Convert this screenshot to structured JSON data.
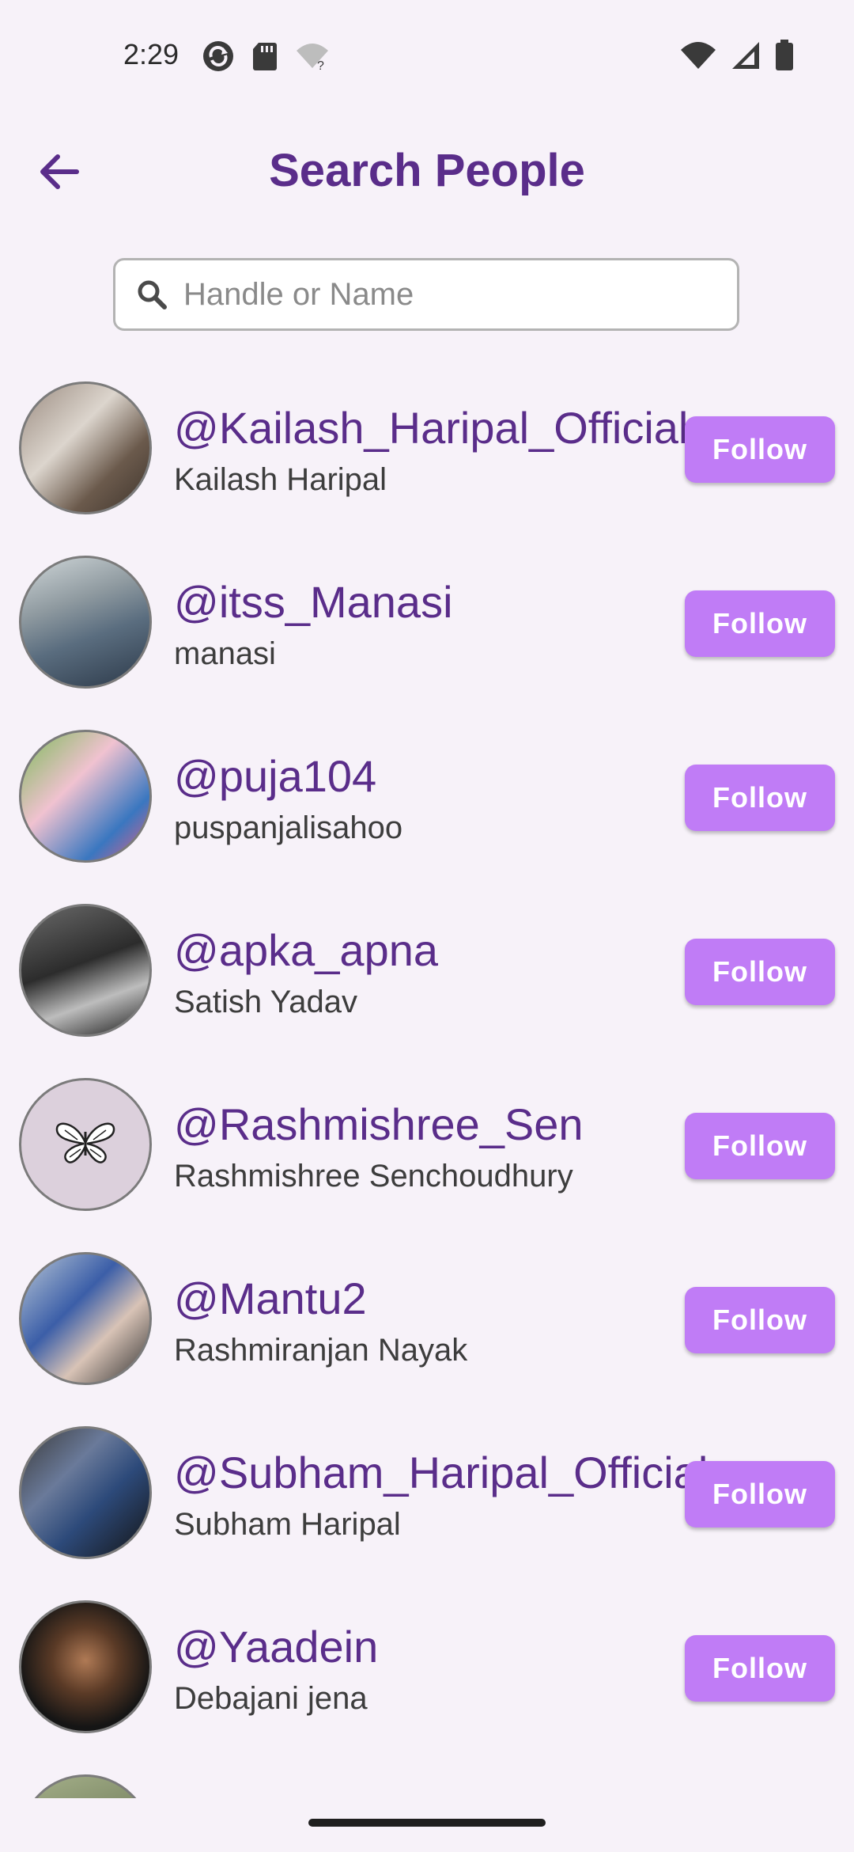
{
  "status_bar": {
    "time": "2:29",
    "left_icons": [
      "sync-icon",
      "sd-card-icon",
      "wifi-question-icon"
    ],
    "right_icons": [
      "wifi-icon",
      "signal-icon",
      "battery-icon"
    ]
  },
  "app_bar": {
    "title": "Search People",
    "back_icon": "arrow-left-icon"
  },
  "search": {
    "placeholder": "Handle or Name",
    "value": ""
  },
  "people": [
    {
      "handle": "@Kailash_Haripal_Official",
      "name": "Kailash Haripal",
      "button": "Follow"
    },
    {
      "handle": "@itss_Manasi",
      "name": "manasi",
      "button": "Follow"
    },
    {
      "handle": "@puja104",
      "name": "puspanjalisahoo",
      "button": "Follow"
    },
    {
      "handle": "@apka_apna",
      "name": "Satish Yadav",
      "button": "Follow"
    },
    {
      "handle": "@Rashmishree_Sen",
      "name": "Rashmishree Senchoudhury",
      "button": "Follow"
    },
    {
      "handle": "@Mantu2",
      "name": "Rashmiranjan Nayak",
      "button": "Follow"
    },
    {
      "handle": "@Subham_Haripal_Official",
      "name": "Subham Haripal",
      "button": "Follow"
    },
    {
      "handle": "@Yaadein",
      "name": "Debajani jena",
      "button": "Follow"
    }
  ],
  "colors": {
    "accent": "#5a2d8a",
    "button": "#c07cf6",
    "background": "#f7f2f9"
  }
}
